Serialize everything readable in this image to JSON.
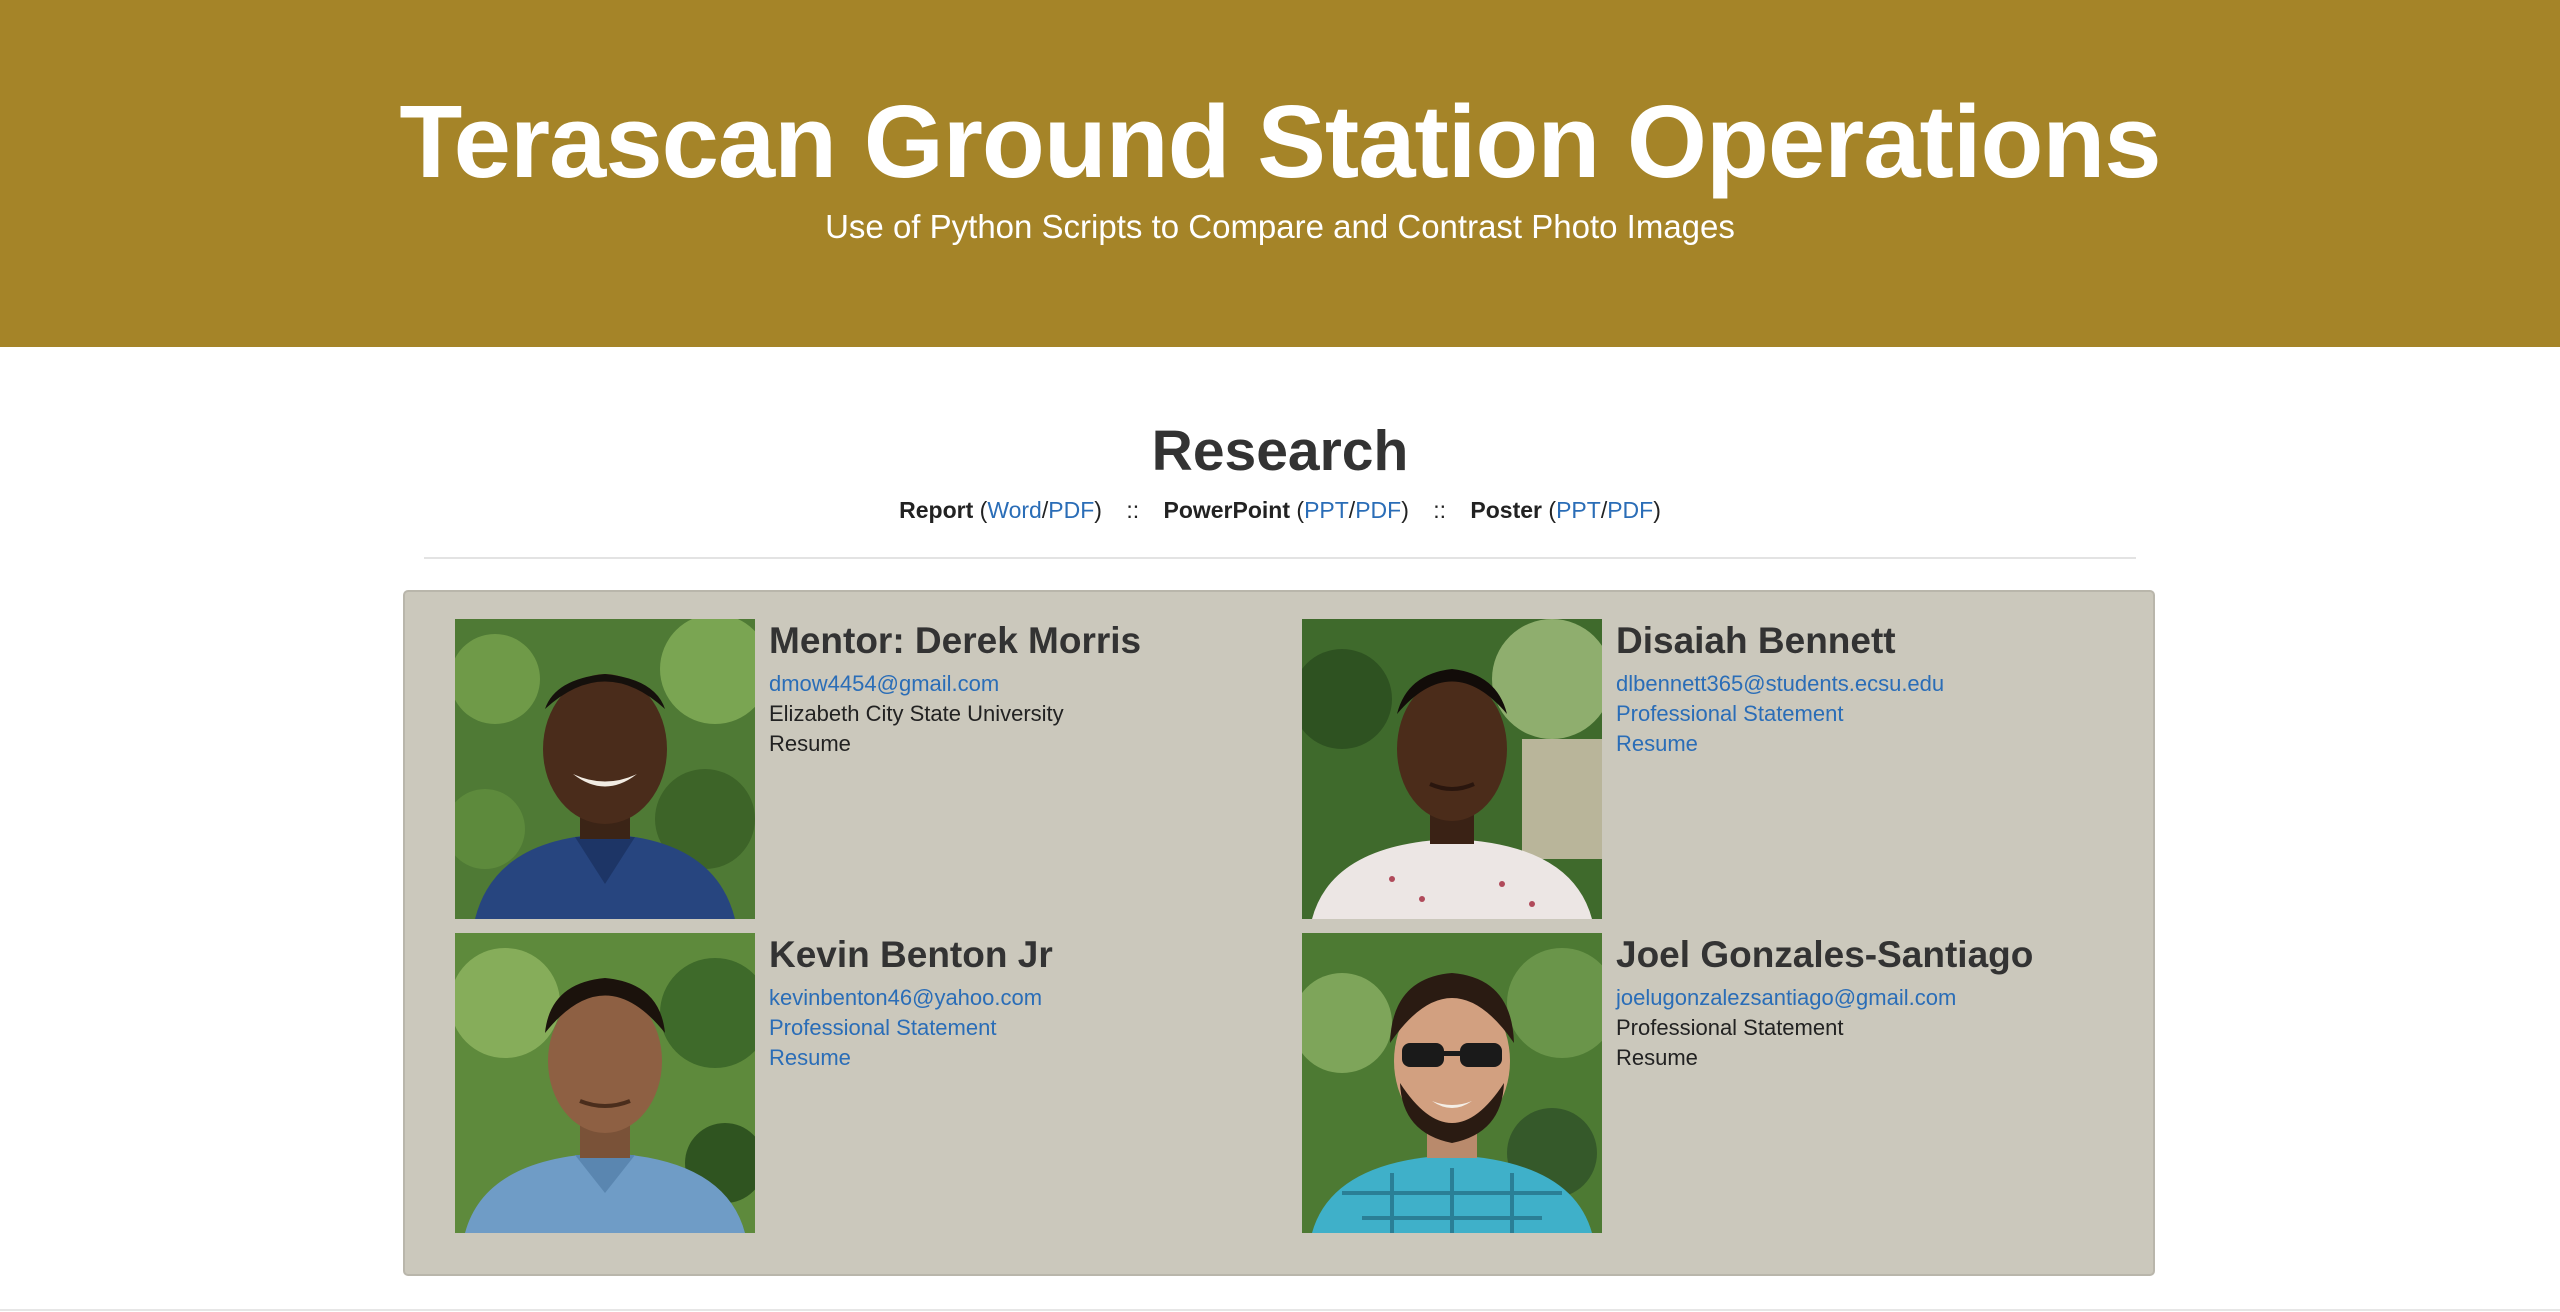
{
  "header": {
    "title": "Terascan Ground Station Operations",
    "subtitle": "Use of Python Scripts to Compare and Contrast Photo Images"
  },
  "research": {
    "heading": "Research",
    "report_label": "Report",
    "report_word": "Word",
    "report_pdf": "PDF",
    "separator": "::",
    "powerpoint_label": "PowerPoint",
    "powerpoint_ppt": "PPT",
    "powerpoint_pdf": "PDF",
    "poster_label": "Poster",
    "poster_ppt": "PPT",
    "poster_pdf": "PDF"
  },
  "people": [
    {
      "name": "Mentor: Derek Morris",
      "email": "dmow4454@gmail.com",
      "line2": "Elizabeth City State University",
      "line3": "Resume"
    },
    {
      "name": "Disaiah Bennett",
      "email": "dlbennett365@students.ecsu.edu",
      "line2": "Professional Statement",
      "line3": "Resume"
    },
    {
      "name": "Kevin Benton Jr",
      "email": "kevinbenton46@yahoo.com",
      "line2": "Professional Statement",
      "line3": "Resume"
    },
    {
      "name": "Joel Gonzales-Santiago",
      "email": "joelugonzalezsantiago@gmail.com",
      "line2": "Professional Statement",
      "line3": "Resume"
    }
  ],
  "colors": {
    "header_bg": "#a58428",
    "panel_bg": "#cbc8bc",
    "link": "#2a6db7"
  }
}
